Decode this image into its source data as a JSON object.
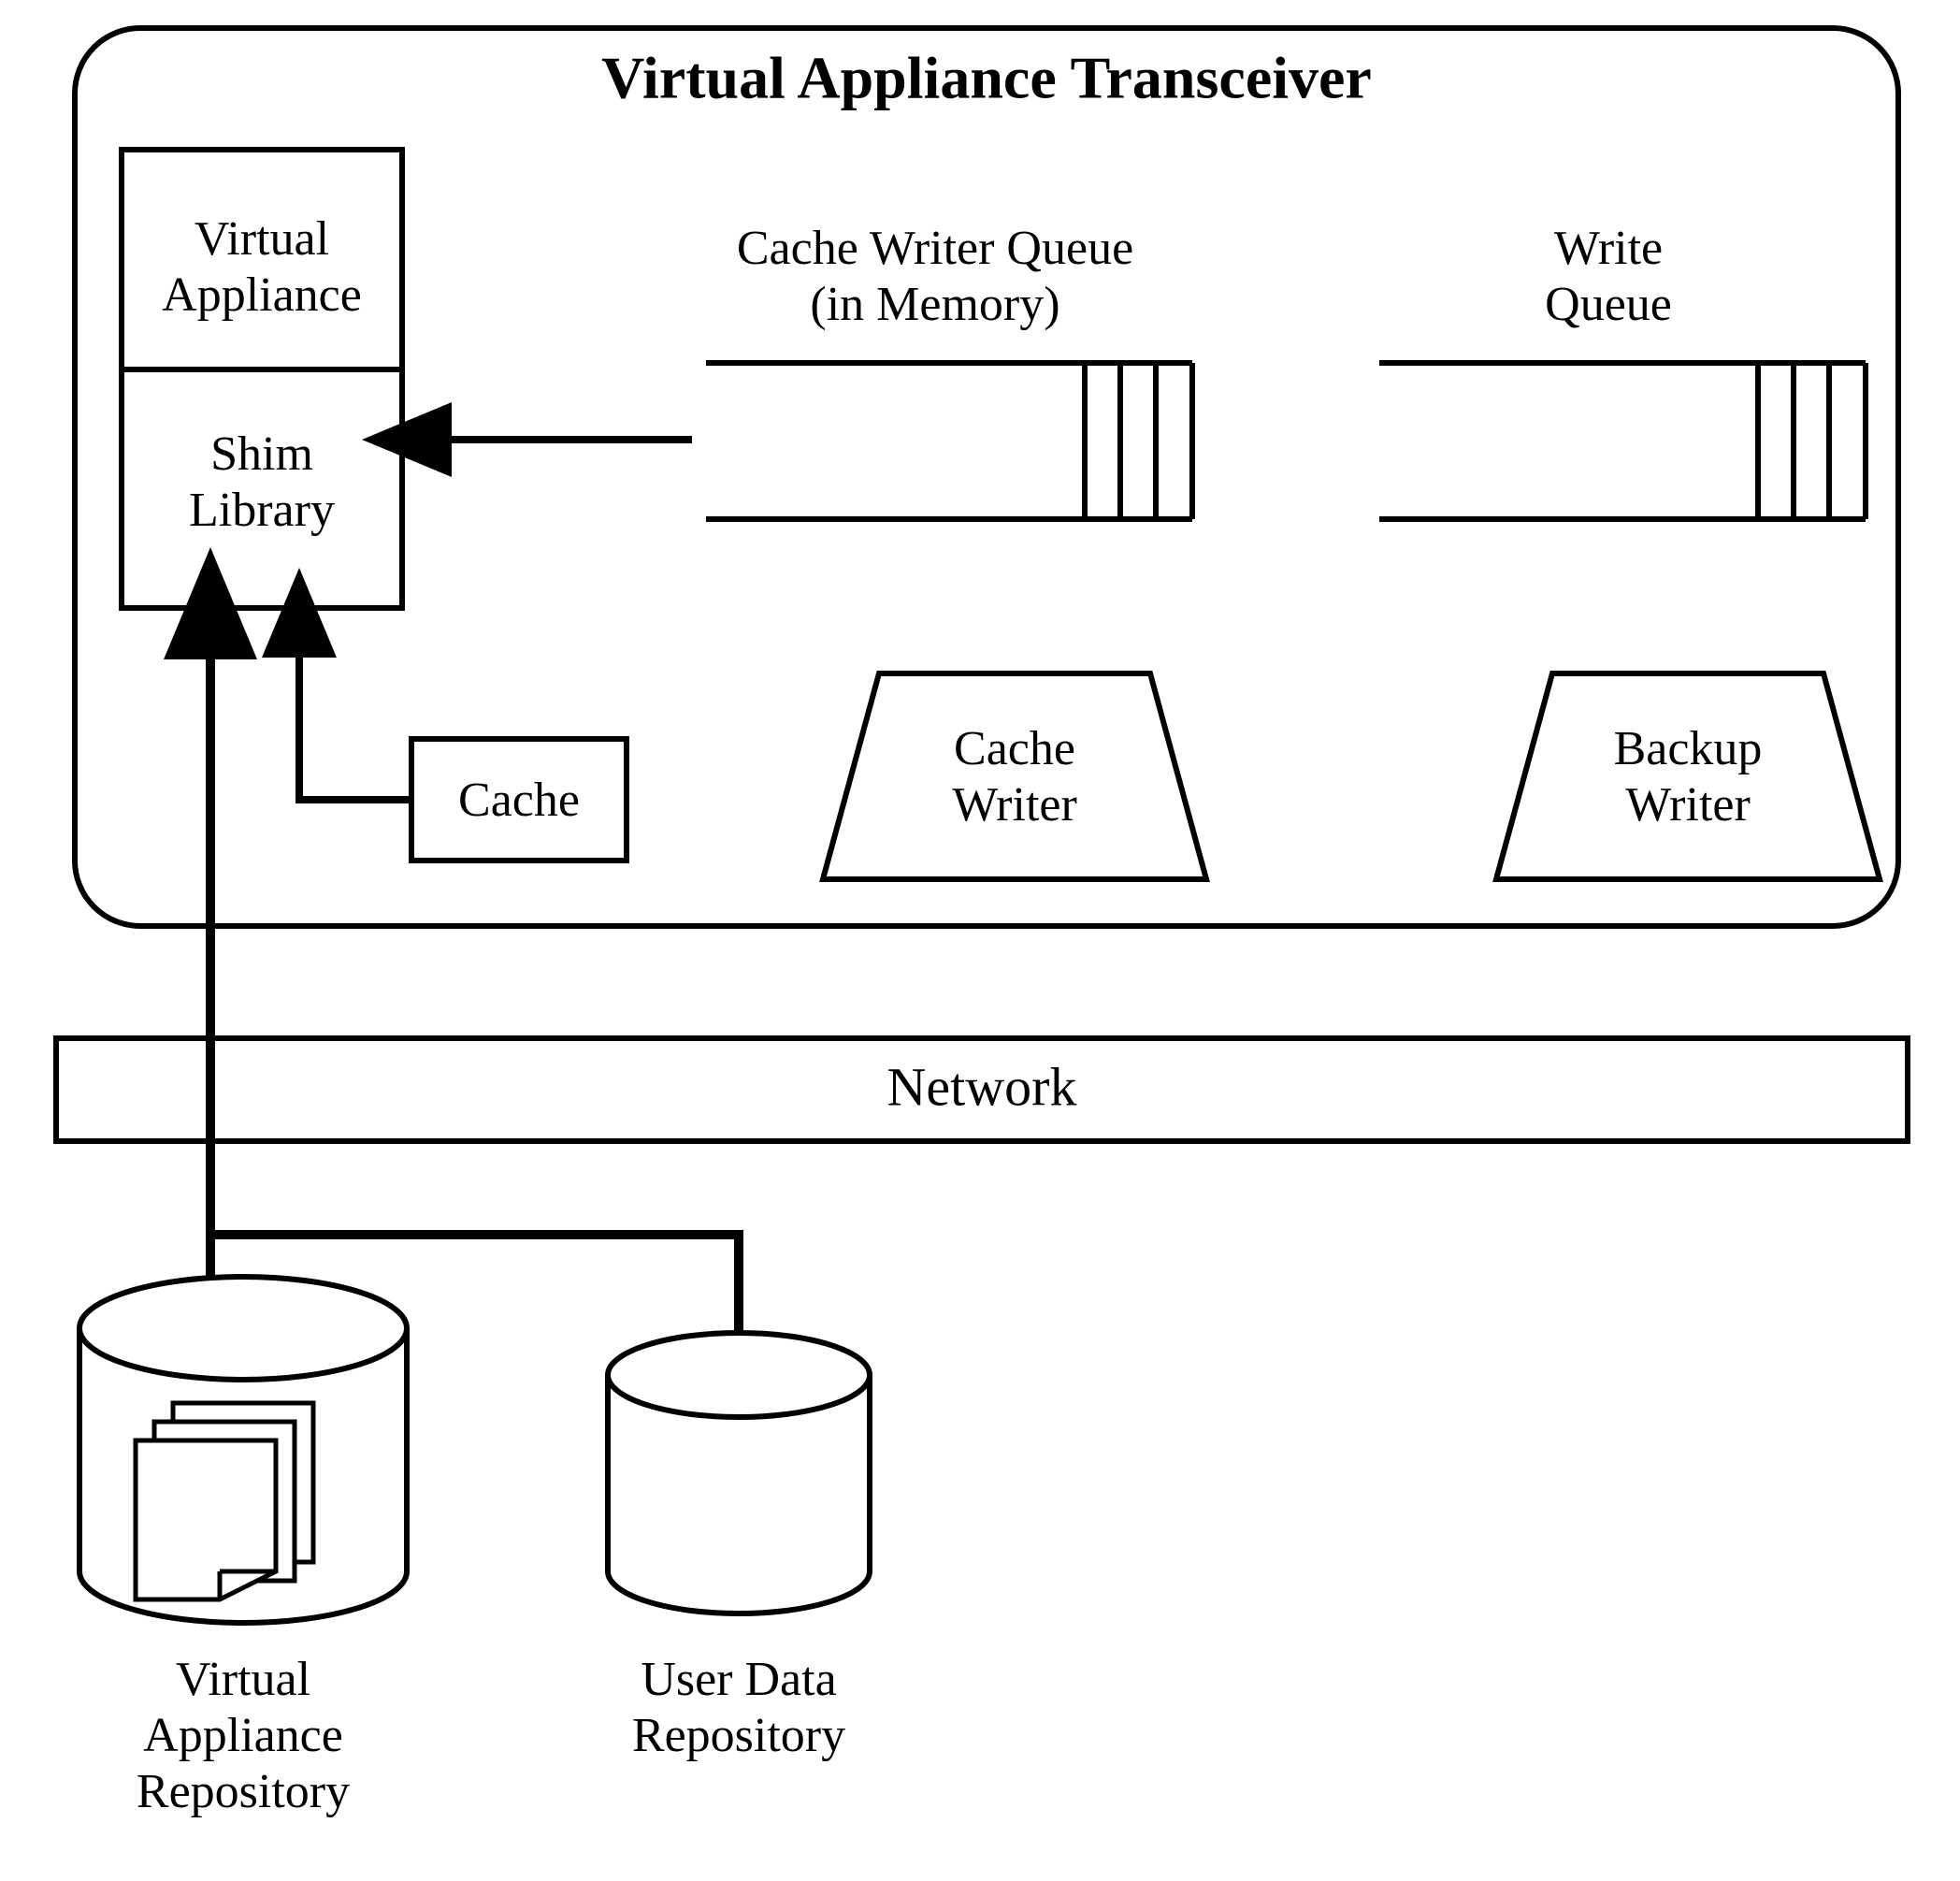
{
  "title": "Virtual Appliance Transceiver",
  "boxes": {
    "virtual_appliance_l1": "Virtual",
    "virtual_appliance_l2": "Appliance",
    "shim_library_l1": "Shim",
    "shim_library_l2": "Library",
    "cache": "Cache"
  },
  "labels": {
    "cache_writer_queue_l1": "Cache Writer Queue",
    "cache_writer_queue_l2": "(in Memory)",
    "write_queue_l1": "Write",
    "write_queue_l2": "Queue",
    "cache_writer_l1": "Cache",
    "cache_writer_l2": "Writer",
    "backup_writer_l1": "Backup",
    "backup_writer_l2": "Writer",
    "network": "Network",
    "va_repo_l1": "Virtual",
    "va_repo_l2": "Appliance",
    "va_repo_l3": "Repository",
    "user_repo_l1": "User Data",
    "user_repo_l2": "Repository"
  }
}
